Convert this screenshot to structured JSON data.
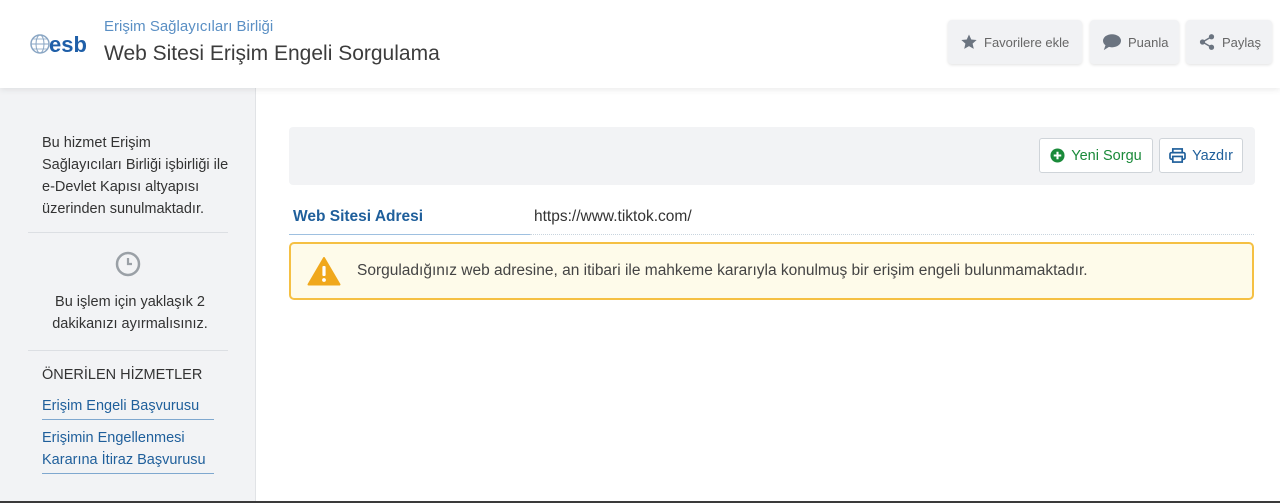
{
  "header": {
    "logo_text": "esb",
    "org_name": "Erişim Sağlayıcıları Birliği",
    "service_title": "Web Sitesi Erişim Engeli Sorgulama",
    "buttons": {
      "favorite": "Favorilere ekle",
      "rate": "Puanla",
      "share": "Paylaş"
    }
  },
  "sidebar": {
    "info_text": "Bu hizmet Erişim Sağlayıcıları Birliği işbirliği ile e-Devlet Kapısı altyapısı üzerinden sunulmaktadır.",
    "time_text": "Bu işlem için yaklaşık 2 dakikanızı ayırmalısınız.",
    "recommended_heading": "ÖNERİLEN HİZMETLER",
    "recommended_links": [
      "Erişim Engeli Başvurusu",
      "Erişimin Engellenmesi Kararına İtiraz Başvurusu"
    ]
  },
  "toolbar": {
    "new_query": "Yeni Sorgu",
    "print": "Yazdır"
  },
  "result": {
    "label": "Web Sitesi Adresi",
    "value": "https://www.tiktok.com/"
  },
  "alert": {
    "message": "Sorguladığınız web adresine, an itibari ile mahkeme kararıyla konulmuş bir erişim engeli bulunmamaktadır."
  },
  "colors": {
    "link_blue": "#1f5f9b",
    "org_blue": "#5a8fc4",
    "green": "#1a8a3a",
    "warning_yellow": "#f5c043",
    "warning_bg": "#fefbea",
    "sidebar_bg": "#f2f3f5"
  },
  "icons": {
    "logo": "esb-globe-logo",
    "favorite": "star-icon",
    "rate": "speech-bubble-icon",
    "share": "share-icon",
    "time": "clock-icon",
    "new_query": "plus-circle-icon",
    "print": "printer-icon",
    "warning": "warning-triangle-icon"
  }
}
